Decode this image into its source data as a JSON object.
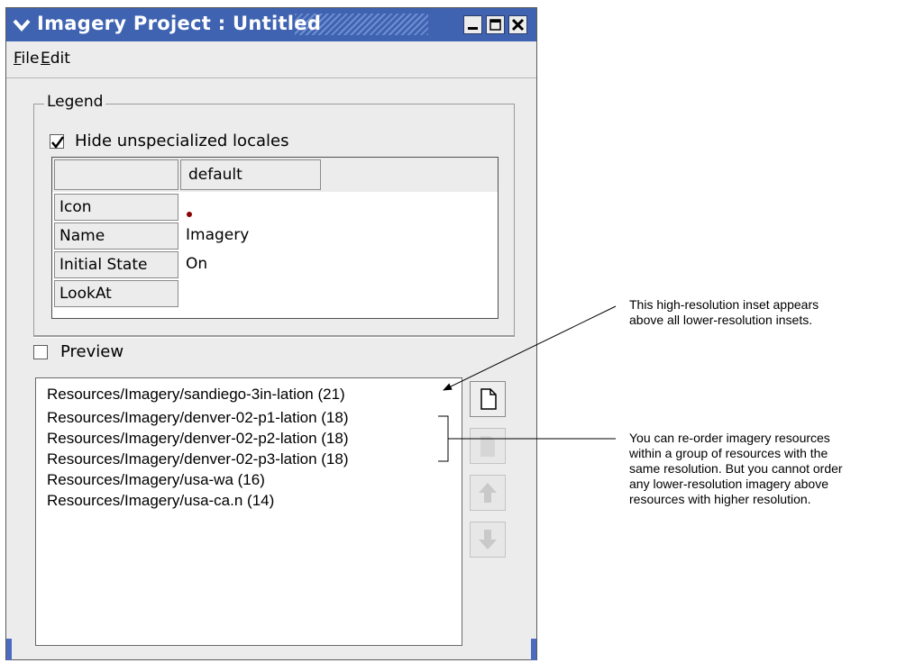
{
  "window": {
    "title": "Imagery Project : Untitled"
  },
  "menubar": {
    "file": {
      "mnemonic": "F",
      "rest": "ile"
    },
    "edit": {
      "mnemonic": "E",
      "rest": "dit"
    }
  },
  "legend": {
    "title": "Legend",
    "hide_unspecialized": {
      "label": "Hide unspecialized locales",
      "checked": true
    },
    "table": {
      "column_header": "default",
      "rows": [
        {
          "label": "Icon",
          "value": "",
          "icon": "dark-red-dot"
        },
        {
          "label": "Name",
          "value": "Imagery"
        },
        {
          "label": "Initial State",
          "value": "On"
        },
        {
          "label": "LookAt",
          "value": ""
        }
      ]
    }
  },
  "preview": {
    "label": "Preview",
    "checked": false
  },
  "resources": [
    "Resources/Imagery/sandiego-3in-lation (21)",
    "Resources/Imagery/denver-02-p1-lation (18)",
    "Resources/Imagery/denver-02-p2-lation (18)",
    "Resources/Imagery/denver-02-p3-lation (18)",
    "Resources/Imagery/usa-wa (16)",
    "Resources/Imagery/usa-ca.n (14)"
  ],
  "side_buttons": [
    {
      "icon": "new-document-icon",
      "enabled": true
    },
    {
      "icon": "document-icon",
      "enabled": false
    },
    {
      "icon": "arrow-up-icon",
      "enabled": false
    },
    {
      "icon": "arrow-down-icon",
      "enabled": false
    }
  ],
  "callouts": {
    "high_res": [
      "This high-resolution inset appears",
      "above all lower-resolution insets."
    ],
    "reorder": [
      "You can re-order imagery resources",
      "within a group of resources with the",
      "same resolution. But you cannot order",
      "any lower-resolution imagery above",
      "resources with higher resolution."
    ]
  },
  "colors": {
    "titlebar": "#3f63b1",
    "window_bg": "#ececec",
    "icon_dot": "#8b0000"
  }
}
